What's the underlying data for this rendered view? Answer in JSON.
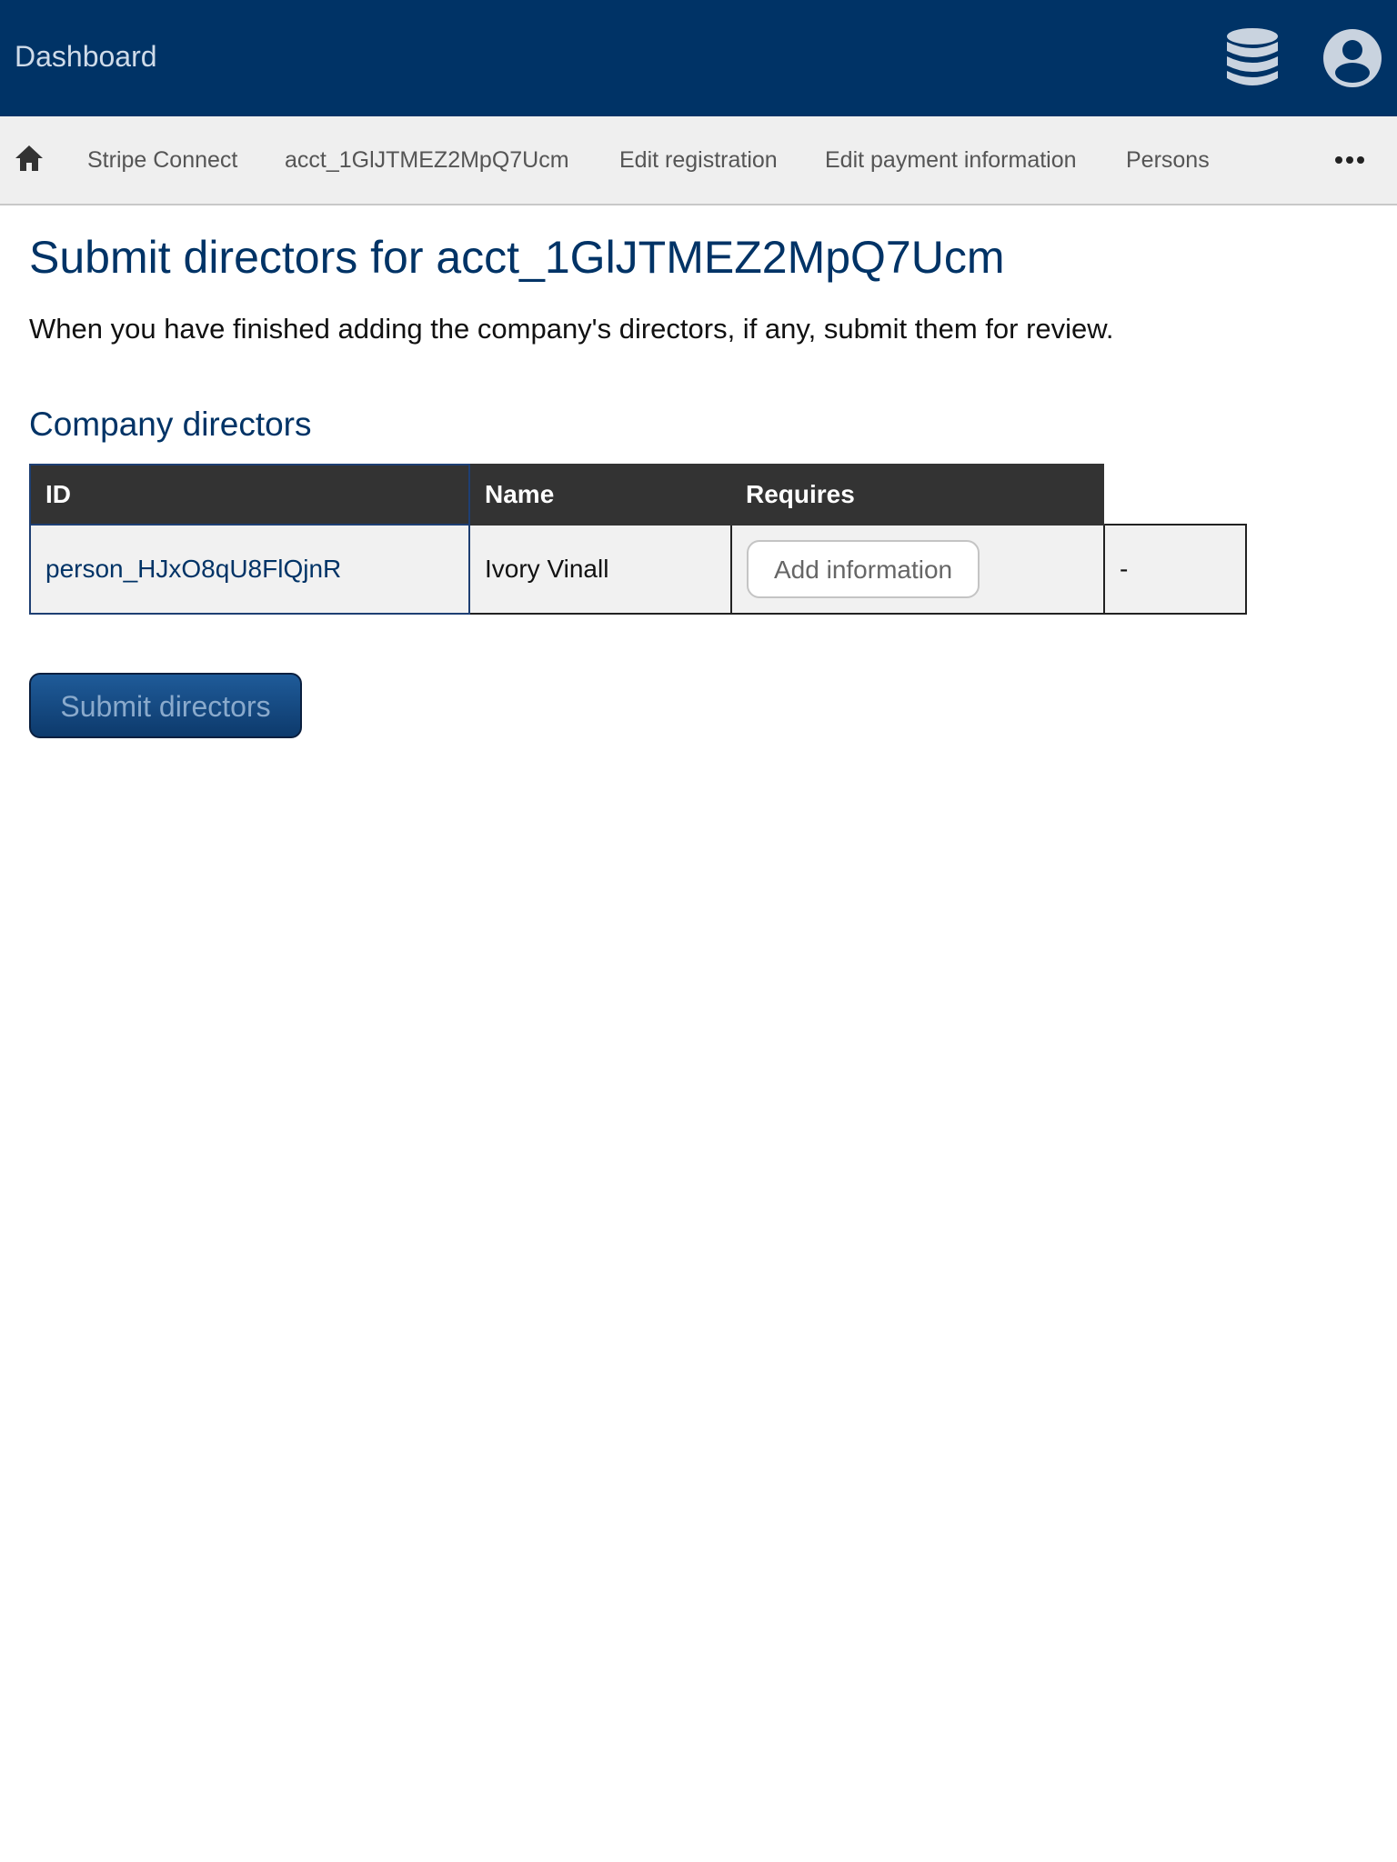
{
  "header": {
    "brand": "Dashboard",
    "icons": [
      "database-icon",
      "user-account-icon"
    ],
    "colors": {
      "background": "#003366",
      "brand_text": "#cfdbe9",
      "icon": "#c9d3df"
    }
  },
  "nav": {
    "home_icon": "home-icon",
    "items": [
      {
        "label": "Stripe Connect"
      },
      {
        "label": "acct_1GlJTMEZ2MpQ7Ucm"
      },
      {
        "label": "Edit registration"
      },
      {
        "label": "Edit payment information"
      },
      {
        "label": "Persons"
      }
    ],
    "more_icon": "more-dots-icon"
  },
  "page": {
    "title": "Submit directors for acct_1GlJTMEZ2MpQ7Ucm",
    "intro": "When you have finished adding the company's directors, if any, submit them for review.",
    "section_title": "Company directors"
  },
  "table": {
    "headers": [
      "ID",
      "Name",
      "Requires"
    ],
    "rows": [
      {
        "id": "person_HJxO8qU8FlQjnR",
        "name": "Ivory Vinall",
        "requires_button": "Add information",
        "extra": "-"
      }
    ]
  },
  "actions": {
    "submit_label": "Submit directors"
  }
}
